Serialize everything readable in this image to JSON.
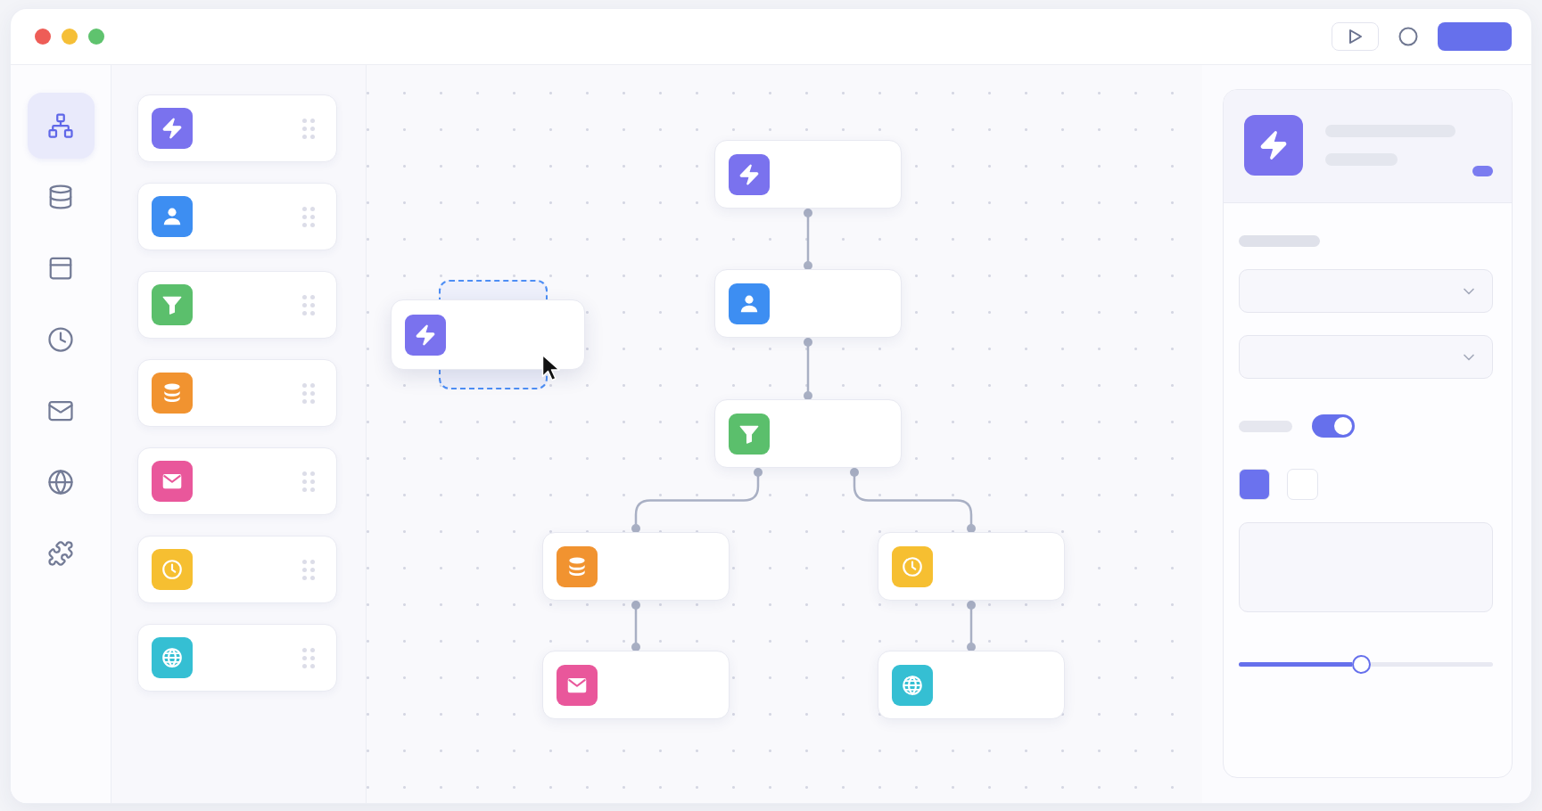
{
  "window": {
    "buttons": [
      {
        "kind": "close"
      },
      {
        "kind": "minimize"
      },
      {
        "kind": "zoom"
      }
    ]
  },
  "toolbar": {
    "buttons": [
      {
        "kind": "run"
      },
      {
        "kind": "record"
      },
      {
        "kind": "primary"
      }
    ]
  },
  "sidebar": {
    "items": [
      {
        "kind": "flow",
        "selected": true
      },
      {
        "kind": "database",
        "selected": false
      },
      {
        "kind": "panel",
        "selected": false
      },
      {
        "kind": "clock",
        "selected": false
      },
      {
        "kind": "mail",
        "selected": false
      },
      {
        "kind": "globe",
        "selected": false
      },
      {
        "kind": "puzzle",
        "selected": false
      }
    ]
  },
  "palette": {
    "items": [
      {
        "kind": "bolt",
        "color": "#7a72ee"
      },
      {
        "kind": "person",
        "color": "#3d8ef2"
      },
      {
        "kind": "funnel",
        "color": "#5bbf6c"
      },
      {
        "kind": "database",
        "color": "#f19330"
      },
      {
        "kind": "mail",
        "color": "#e9579b"
      },
      {
        "kind": "clock",
        "color": "#f6bf31"
      },
      {
        "kind": "globe",
        "color": "#35bfd3"
      }
    ]
  },
  "canvas": {
    "dragging": {
      "kind": "bolt",
      "color": "#7a72ee"
    },
    "flow": {
      "kind": "bolt",
      "color": "#7a72ee",
      "children": [
        {
          "kind": "person",
          "color": "#3d8ef2",
          "children": [
            {
              "kind": "funnel",
              "color": "#5bbf6c",
              "children": [
                {
                  "kind": "database",
                  "color": "#f19330",
                  "children": [
                    {
                      "kind": "mail",
                      "color": "#e9579b"
                    }
                  ]
                },
                {
                  "kind": "clock",
                  "color": "#f6bf31",
                  "children": [
                    {
                      "kind": "globe",
                      "color": "#35bfd3"
                    }
                  ]
                }
              ]
            }
          ]
        }
      ]
    }
  },
  "inspector": {
    "node": {
      "kind": "bolt",
      "color": "#7a72ee"
    },
    "fields": [
      {
        "kind": "label"
      },
      {
        "kind": "select"
      },
      {
        "kind": "select"
      },
      {
        "kind": "toggle",
        "on": true
      },
      {
        "kind": "swatches",
        "swatches": [
          {
            "color": "#6b72ee"
          },
          {
            "color": "#ffffff"
          }
        ]
      },
      {
        "kind": "textarea"
      },
      {
        "kind": "slider",
        "level": 0.48
      }
    ]
  }
}
